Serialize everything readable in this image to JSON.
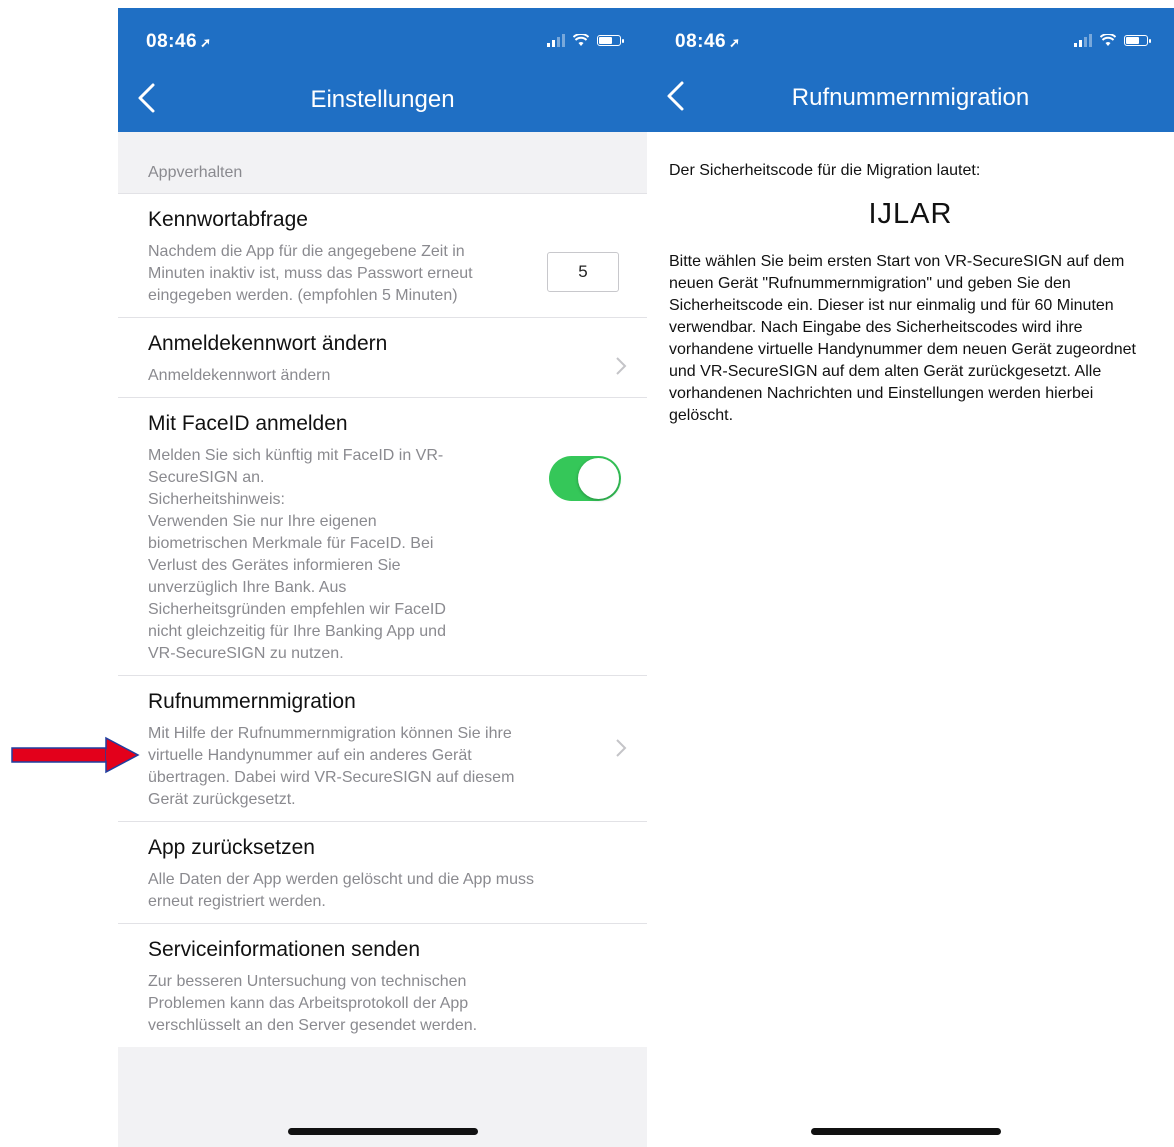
{
  "left": {
    "status": {
      "time": "08:46"
    },
    "header": {
      "title": "Einstellungen"
    },
    "section_label": "Appverhalten",
    "items": [
      {
        "title": "Kennwortabfrage",
        "desc": "Nachdem die App für die angegebene Zeit in\nMinuten inaktiv ist, muss das Passwort erneut\neingegeben werden. (empfohlen 5 Minuten)",
        "input_value": "5"
      },
      {
        "title": "Anmeldekennwort ändern",
        "desc": "Anmeldekennwort ändern"
      },
      {
        "title": "Mit FaceID anmelden",
        "desc": "Melden Sie sich künftig mit FaceID in VR-\nSecureSIGN an.\nSicherheitshinweis:\nVerwenden Sie nur Ihre eigenen\nbiometrischen Merkmale für FaceID. Bei\nVerlust des Gerätes informieren Sie\nunverzüglich Ihre Bank. Aus\nSicherheitsgründen empfehlen wir FaceID\nnicht gleichzeitig für Ihre Banking App und\nVR-SecureSIGN zu nutzen.",
        "toggle_on": true
      },
      {
        "title": "Rufnummernmigration",
        "desc": "Mit Hilfe der Rufnummernmigration können Sie ihre\nvirtuelle Handynummer auf ein anderes Gerät\nübertragen. Dabei wird VR-SecureSIGN auf diesem\nGerät zurückgesetzt."
      },
      {
        "title": "App zurücksetzen",
        "desc": "Alle Daten der App werden gelöscht und die App muss\nerneut registriert werden."
      },
      {
        "title": "Serviceinformationen senden",
        "desc": "Zur besseren Untersuchung von technischen\nProblemen kann das Arbeitsprotokoll der App\nverschlüsselt an den Server gesendet werden."
      }
    ]
  },
  "right": {
    "status": {
      "time": "08:46"
    },
    "header": {
      "title": "Rufnummernmigration"
    },
    "intro": "Der Sicherheitscode für die Migration lautet:",
    "code": "IJLAR",
    "body": "Bitte wählen Sie beim ersten Start von VR-SecureSIGN auf dem neuen Gerät \"Rufnummernmigration\" und geben Sie den Sicherheitscode ein. Dieser ist nur einmalig und für 60 Minuten verwendbar. Nach Eingabe des Sicherheitscodes wird ihre vorhandene virtuelle Handynummer dem neuen Gerät zugeordnet und VR-SecureSIGN auf dem alten Gerät zurückgesetzt. Alle vorhandenen Nachrichten und Einstellungen werden hierbei gelöscht."
  },
  "colors": {
    "header_blue": "#1f6fc4",
    "toggle_green": "#35c759",
    "annotation_red": "#e3001b"
  },
  "icons": [
    "location-arrow-icon",
    "signal-icon",
    "wifi-icon",
    "battery-icon",
    "back-chevron-icon",
    "chevron-right-icon",
    "red-arrow-icon"
  ]
}
